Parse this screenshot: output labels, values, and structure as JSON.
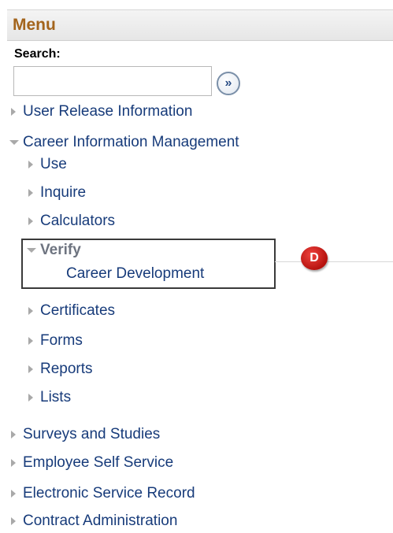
{
  "menu": {
    "title": "Menu",
    "search_label": "Search:",
    "search_value": "",
    "go_icon": "»"
  },
  "nav": {
    "user_release_information": "User Release Information",
    "career_information_management": "Career Information Management",
    "use": "Use",
    "inquire": "Inquire",
    "calculators": "Calculators",
    "verify": "Verify",
    "career_development": "Career Development",
    "certificates": "Certificates",
    "forms": "Forms",
    "reports": "Reports",
    "lists": "Lists",
    "surveys_and_studies": "Surveys and Studies",
    "employee_self_service": "Employee Self Service",
    "electronic_service_record": "Electronic Service Record",
    "contract_administration": "Contract Administration"
  },
  "annotation": {
    "callout_label": "D",
    "callout_color": "#d4201b",
    "box_color": "#3a3a3a"
  },
  "colors": {
    "link": "#173b7a",
    "menu_title": "#a3641c"
  }
}
